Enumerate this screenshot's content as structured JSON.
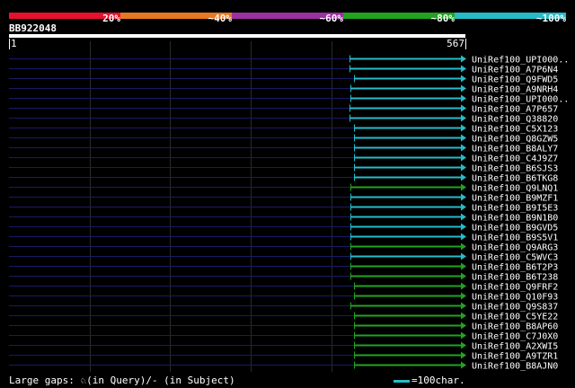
{
  "legend": {
    "segments": [
      {
        "label": "20%",
        "color": "#e8112d"
      },
      {
        "label": "~40%",
        "color": "#e87722"
      },
      {
        "label": "~60%",
        "color": "#9b30a0"
      },
      {
        "label": "~80%",
        "color": "#21a321"
      },
      {
        "label": "~100%",
        "color": "#25bcc8"
      }
    ]
  },
  "query": {
    "name": "BB922048",
    "start": "1",
    "end": "567"
  },
  "hits": [
    {
      "name": "UniRef100_UPI000..",
      "color": "#25bcc8",
      "start": 0.747
    },
    {
      "name": "UniRef100_A7P6N4",
      "color": "#25bcc8",
      "start": 0.747
    },
    {
      "name": "UniRef100_Q9FWD5",
      "color": "#25bcc8",
      "start": 0.755
    },
    {
      "name": "UniRef100_A9NRH4",
      "color": "#25bcc8",
      "start": 0.749
    },
    {
      "name": "UniRef100_UPI000..",
      "color": "#25bcc8",
      "start": 0.749
    },
    {
      "name": "UniRef100_A7P657",
      "color": "#25bcc8",
      "start": 0.747
    },
    {
      "name": "UniRef100_Q38820",
      "color": "#25bcc8",
      "start": 0.747
    },
    {
      "name": "UniRef100_C5X123",
      "color": "#25bcc8",
      "start": 0.755
    },
    {
      "name": "UniRef100_Q8GZW5",
      "color": "#25bcc8",
      "start": 0.755
    },
    {
      "name": "UniRef100_B8ALY7",
      "color": "#25bcc8",
      "start": 0.755
    },
    {
      "name": "UniRef100_C4J9Z7",
      "color": "#25bcc8",
      "start": 0.755
    },
    {
      "name": "UniRef100_B6SJS3",
      "color": "#25bcc8",
      "start": 0.755
    },
    {
      "name": "UniRef100_B6TKG8",
      "color": "#25bcc8",
      "start": 0.755
    },
    {
      "name": "UniRef100_Q9LNQ1",
      "color": "#21a321",
      "start": 0.749
    },
    {
      "name": "UniRef100_B9MZF1",
      "color": "#25bcc8",
      "start": 0.749
    },
    {
      "name": "UniRef100_B9I5E3",
      "color": "#25bcc8",
      "start": 0.749
    },
    {
      "name": "UniRef100_B9N1B0",
      "color": "#25bcc8",
      "start": 0.749
    },
    {
      "name": "UniRef100_B9GVD5",
      "color": "#25bcc8",
      "start": 0.749
    },
    {
      "name": "UniRef100_B9S5V1",
      "color": "#25bcc8",
      "start": 0.749
    },
    {
      "name": "UniRef100_Q9ARG3",
      "color": "#21a321",
      "start": 0.749
    },
    {
      "name": "UniRef100_C5WVC3",
      "color": "#25bcc8",
      "start": 0.749
    },
    {
      "name": "UniRef100_B6T2P3",
      "color": "#21a321",
      "start": 0.749
    },
    {
      "name": "UniRef100_B6T238",
      "color": "#21a321",
      "start": 0.749
    },
    {
      "name": "UniRef100_Q9FRF2",
      "color": "#21a321",
      "start": 0.755
    },
    {
      "name": "UniRef100_Q10F93",
      "color": "#21a321",
      "start": 0.755
    },
    {
      "name": "UniRef100_Q9S837",
      "color": "#21a321",
      "start": 0.749
    },
    {
      "name": "UniRef100_C5YE22",
      "color": "#21a321",
      "start": 0.755
    },
    {
      "name": "UniRef100_B8AP60",
      "color": "#21a321",
      "start": 0.755
    },
    {
      "name": "UniRef100_C7J0X0",
      "color": "#21a321",
      "start": 0.755
    },
    {
      "name": "UniRef100_A2XWI5",
      "color": "#21a321",
      "start": 0.755
    },
    {
      "name": "UniRef100_A9TZR1",
      "color": "#21a321",
      "start": 0.755
    },
    {
      "name": "UniRef100_B8AJN0",
      "color": "#21a321",
      "start": 0.755
    }
  ],
  "footer": {
    "gaps_text": "Large gaps: ♘(in Query)/- (in Subject)",
    "scale_text": "=100char.",
    "scale_color": "#25bcc8"
  }
}
